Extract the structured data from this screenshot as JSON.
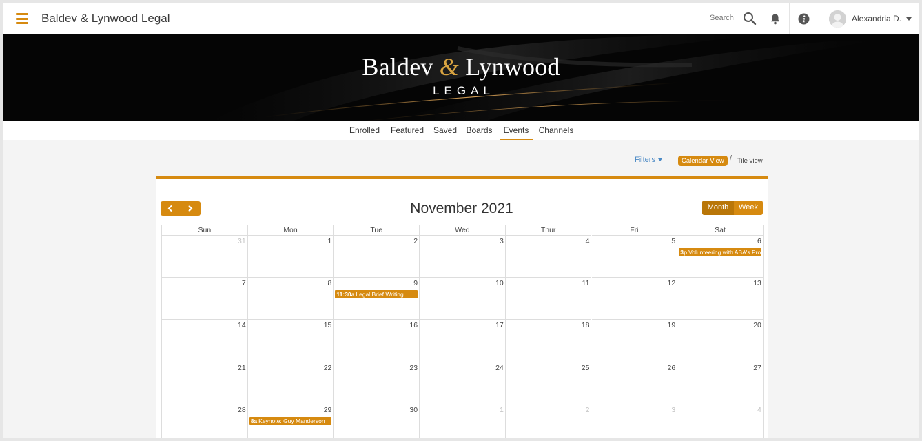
{
  "app": {
    "title": "Baldev & Lynwood Legal"
  },
  "header": {
    "search_label": "Search",
    "user_name": "Alexandria D.",
    "icons": [
      "menu-icon",
      "search-icon",
      "bell-icon",
      "info-icon",
      "avatar",
      "caret-down-icon"
    ]
  },
  "banner": {
    "name_left": "Baldev",
    "ampersand": "&",
    "name_right": "Lynwood",
    "subtitle": "LEGAL"
  },
  "tabs": [
    {
      "label": "Enrolled"
    },
    {
      "label": "Featured"
    },
    {
      "label": "Saved"
    },
    {
      "label": "Boards"
    },
    {
      "label": "Events",
      "active": true
    },
    {
      "label": "Channels"
    }
  ],
  "controls": {
    "filters_label": "Filters",
    "calendar_view_label": "Calendar View",
    "separator": "/",
    "tile_view_label": "Tile view"
  },
  "calendar": {
    "month_title": "November 2021",
    "view_month_label": "Month",
    "view_week_label": "Week",
    "weekdays": [
      "Sun",
      "Mon",
      "Tue",
      "Wed",
      "Thur",
      "Fri",
      "Sat"
    ],
    "weeks": [
      [
        {
          "n": "31",
          "other": true
        },
        {
          "n": "1"
        },
        {
          "n": "2"
        },
        {
          "n": "3"
        },
        {
          "n": "4"
        },
        {
          "n": "5"
        },
        {
          "n": "6",
          "event": {
            "time": "3p",
            "title": "Volunteering with ABA's Pro Bono"
          }
        }
      ],
      [
        {
          "n": "7"
        },
        {
          "n": "8"
        },
        {
          "n": "9",
          "event": {
            "time": "11:30a",
            "title": "Legal Brief Writing"
          }
        },
        {
          "n": "10"
        },
        {
          "n": "11"
        },
        {
          "n": "12"
        },
        {
          "n": "13"
        }
      ],
      [
        {
          "n": "14"
        },
        {
          "n": "15"
        },
        {
          "n": "16"
        },
        {
          "n": "17"
        },
        {
          "n": "18"
        },
        {
          "n": "19"
        },
        {
          "n": "20"
        }
      ],
      [
        {
          "n": "21"
        },
        {
          "n": "22"
        },
        {
          "n": "23"
        },
        {
          "n": "24"
        },
        {
          "n": "25"
        },
        {
          "n": "26"
        },
        {
          "n": "27"
        }
      ],
      [
        {
          "n": "28"
        },
        {
          "n": "29",
          "event": {
            "time": "8a",
            "title": "Keynote: Guy Manderson"
          }
        },
        {
          "n": "30"
        },
        {
          "n": "1",
          "other": true
        },
        {
          "n": "2",
          "other": true
        },
        {
          "n": "3",
          "other": true
        },
        {
          "n": "4",
          "other": true
        }
      ]
    ]
  },
  "colors": {
    "accent": "#d68a10",
    "accent_dark": "#b97608",
    "link": "#4a89c5",
    "banner_bg": "#050505",
    "banner_gold": "#d9a441"
  }
}
